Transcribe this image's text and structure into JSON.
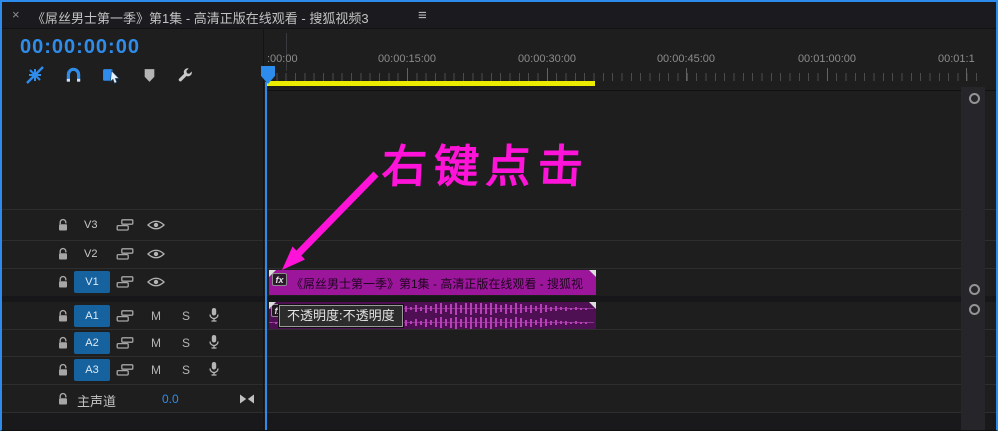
{
  "tab": {
    "close_label": "×",
    "title": "《屌丝男士第一季》第1集 - 高清正版在线观看 - 搜狐视频3",
    "menu_icon": "≡"
  },
  "timecode": {
    "value": "00:00:00:00"
  },
  "toolbar": {
    "icons": [
      "nest-insert-toggle",
      "snap-magnet",
      "linked-selection",
      "add-marker",
      "timeline-settings-wrench"
    ]
  },
  "ruler": {
    "labels": [
      ":00:00",
      "00:00:15:00",
      "00:00:30:00",
      "00:00:45:00",
      "00:01:00:00",
      "00:01:1"
    ]
  },
  "tracks": {
    "video": [
      {
        "id": "V3",
        "targeted": false
      },
      {
        "id": "V2",
        "targeted": false
      },
      {
        "id": "V1",
        "targeted": true
      }
    ],
    "audio": [
      {
        "id": "A1",
        "targeted": true
      },
      {
        "id": "A2",
        "targeted": true
      },
      {
        "id": "A3",
        "targeted": true
      }
    ],
    "audio_controls": {
      "mute": "M",
      "solo": "S"
    },
    "master": {
      "label": "主声道",
      "gain": "0.0"
    }
  },
  "clips": {
    "video": {
      "fx_badge": "fx",
      "title": "《屌丝男士第一季》第1集 - 高清正版在线观看 - 搜狐视"
    },
    "audio": {
      "fx_badge": "fx",
      "waveform": [
        1,
        2,
        1,
        1,
        2,
        1,
        2,
        1,
        1,
        2,
        2,
        1,
        2,
        1,
        3,
        2,
        1,
        2,
        2,
        3,
        2,
        4,
        2,
        3,
        5,
        3,
        2,
        6,
        3,
        7,
        4,
        8,
        5,
        9,
        11,
        7,
        10,
        12,
        8,
        11,
        12,
        9,
        11,
        10,
        12,
        9,
        7,
        10,
        8,
        11,
        9,
        6,
        8,
        5,
        9,
        7,
        4,
        5,
        3,
        4,
        2,
        3,
        2,
        2
      ]
    }
  },
  "tooltip": {
    "text": "不透明度:不透明度"
  },
  "annotation": {
    "text": "右键点击"
  },
  "colors": {
    "accent_blue": "#2d8ceb",
    "track_target_blue": "#15629f",
    "clip_magenta": "#9c169c",
    "audio_clip_purple": "#4e1053",
    "work_area_yellow": "#ecec00",
    "annotation_pink": "#ff13d9",
    "timecode_blue": "#2f8ceb"
  }
}
